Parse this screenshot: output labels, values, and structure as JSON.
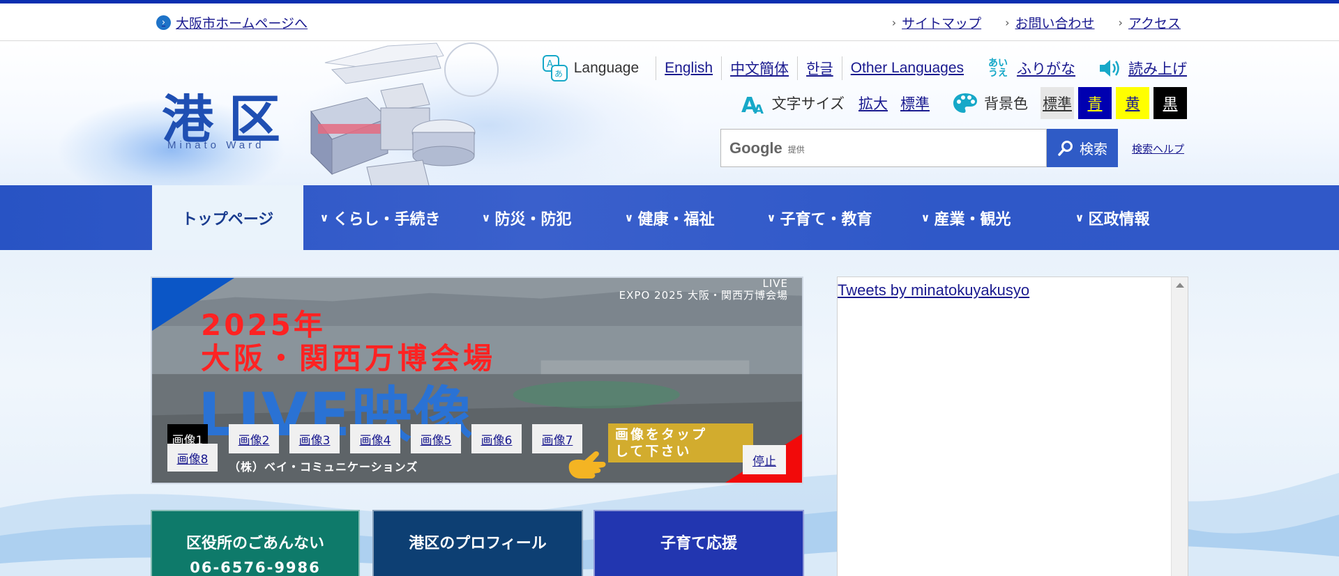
{
  "util": {
    "home_link": "大阪市ホームページへ",
    "links": [
      "サイトマップ",
      "お問い合わせ",
      "アクセス"
    ]
  },
  "header": {
    "logo_main": "港区",
    "logo_sub": "Minato Ward"
  },
  "language": {
    "label": "Language",
    "options": [
      "English",
      "中文簡体",
      "한글",
      "Other Languages"
    ],
    "furigana_icon": "あい うえ",
    "furigana": "ふりがな",
    "read_aloud": "読み上げ"
  },
  "text_size": {
    "label": "文字サイズ",
    "enlarge": "拡大",
    "standard": "標準"
  },
  "background": {
    "label": "背景色",
    "options": [
      {
        "label": "標準",
        "bg": "#e6e6e6",
        "fg": "#333333"
      },
      {
        "label": "青",
        "bg": "#0000b0",
        "fg": "#ffff00"
      },
      {
        "label": "黄",
        "bg": "#ffff00",
        "fg": "#1a1a8f"
      },
      {
        "label": "黒",
        "bg": "#000000",
        "fg": "#ffffff"
      }
    ]
  },
  "search": {
    "google_logo": "Google",
    "google_sub": "提供",
    "placeholder": "",
    "button": "検索",
    "help": "検索ヘルプ"
  },
  "nav": {
    "items": [
      {
        "label": "トップページ",
        "has_chevron": false,
        "active": true
      },
      {
        "label": "くらし・手続き",
        "has_chevron": true,
        "active": false
      },
      {
        "label": "防災・防犯",
        "has_chevron": true,
        "active": false
      },
      {
        "label": "健康・福祉",
        "has_chevron": true,
        "active": false
      },
      {
        "label": "子育て・教育",
        "has_chevron": true,
        "active": false
      },
      {
        "label": "産業・観光",
        "has_chevron": true,
        "active": false
      },
      {
        "label": "区政情報",
        "has_chevron": true,
        "active": false
      }
    ]
  },
  "slideshow": {
    "live_line1": "LIVE",
    "live_line2": "EXPO 2025 大阪・関西万博会場",
    "title1": "2025年",
    "title2": "大阪・関西万博会場",
    "title3": "LIVE映像",
    "tap_line1": "画像をタップ",
    "tap_line2": "して下さい",
    "credit": "（株）ベイ・コミュニケーションズ",
    "thumbs": [
      "画像1",
      "画像2",
      "画像3",
      "画像4",
      "画像5",
      "画像6",
      "画像7",
      "画像8"
    ],
    "active_thumb": "画像1",
    "stop": "停止"
  },
  "tiles": [
    {
      "line1": "区役所のごあんない",
      "line2": "06-6576-9986",
      "color": "#0e7a6a"
    },
    {
      "line1": "港区のプロフィール",
      "line2": "",
      "color": "#0d3f73"
    },
    {
      "line1": "子育て応援",
      "line2": "",
      "color": "#2236b0"
    }
  ],
  "tweets": {
    "link": "Tweets by minatokuyakusyo"
  }
}
